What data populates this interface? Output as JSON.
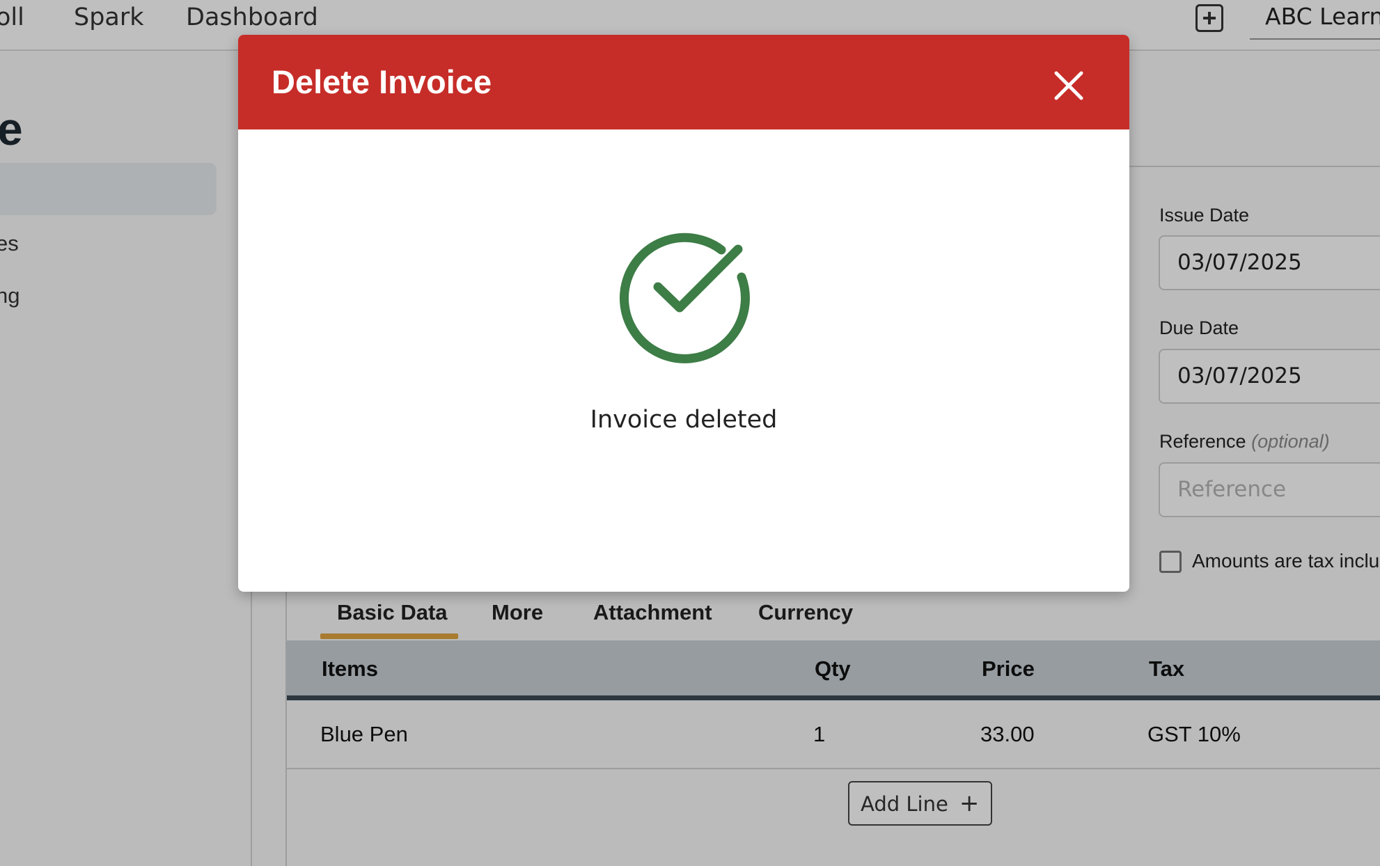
{
  "topnav": {
    "items": [
      "oll",
      "Spark",
      "Dashboard"
    ],
    "org_name": "ABC Learni"
  },
  "page": {
    "heading_fragment": "e",
    "sidebar_items": [
      "es",
      "ng"
    ]
  },
  "form": {
    "issue_date_label": "Issue Date",
    "issue_date_value": "03/07/2025",
    "due_date_label": "Due Date",
    "due_date_value": "03/07/2025",
    "reference_label": "Reference",
    "reference_optional": "(optional)",
    "reference_placeholder": "Reference",
    "tax_inclusive_label": "Amounts are tax inclus"
  },
  "tabs": [
    "Basic Data",
    "More",
    "Attachment",
    "Currency"
  ],
  "table": {
    "columns": [
      "Items",
      "Qty",
      "Price",
      "Tax"
    ],
    "rows": [
      {
        "item": "Blue Pen",
        "qty": "1",
        "price": "33.00",
        "tax": "GST 10%"
      }
    ],
    "add_line_label": "Add Line"
  },
  "modal": {
    "title": "Delete Invoice",
    "message": "Invoice deleted",
    "icon": "check-circle-icon",
    "header_color": "#c62d28",
    "success_color": "#3d7d46"
  }
}
